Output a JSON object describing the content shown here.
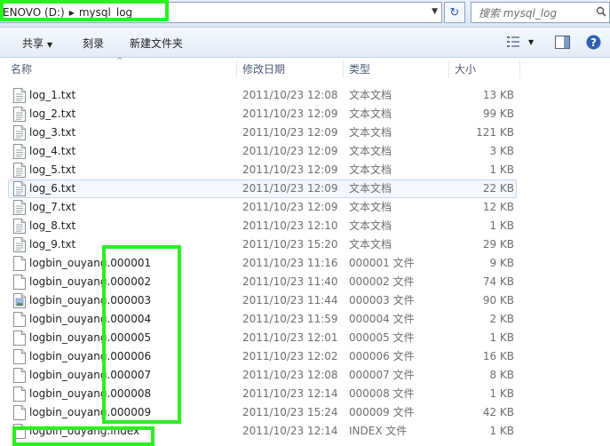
{
  "address": {
    "drive": "ENOVO (D:)",
    "folder": "mysql_log",
    "search_placeholder": "搜索 mysql_log"
  },
  "toolbar": {
    "share": "共享",
    "burn": "刻录",
    "new_folder": "新建文件夹"
  },
  "columns": {
    "name": "名称",
    "date": "修改日期",
    "type": "类型",
    "size": "大小"
  },
  "files": [
    {
      "name": "log_1.txt",
      "date": "2011/10/23 12:08",
      "type": "文本文档",
      "size": "13 KB",
      "icon": "text-file-icon"
    },
    {
      "name": "log_2.txt",
      "date": "2011/10/23 12:09",
      "type": "文本文档",
      "size": "99 KB",
      "icon": "text-file-icon"
    },
    {
      "name": "log_3.txt",
      "date": "2011/10/23 12:09",
      "type": "文本文档",
      "size": "121 KB",
      "icon": "text-file-icon"
    },
    {
      "name": "log_4.txt",
      "date": "2011/10/23 12:09",
      "type": "文本文档",
      "size": "3 KB",
      "icon": "text-file-icon"
    },
    {
      "name": "log_5.txt",
      "date": "2011/10/23 12:09",
      "type": "文本文档",
      "size": "1 KB",
      "icon": "text-file-icon"
    },
    {
      "name": "log_6.txt",
      "date": "2011/10/23 12:09",
      "type": "文本文档",
      "size": "22 KB",
      "icon": "text-file-icon",
      "selected": true
    },
    {
      "name": "log_7.txt",
      "date": "2011/10/23 12:09",
      "type": "文本文档",
      "size": "12 KB",
      "icon": "text-file-icon"
    },
    {
      "name": "log_8.txt",
      "date": "2011/10/23 12:10",
      "type": "文本文档",
      "size": "1 KB",
      "icon": "text-file-icon"
    },
    {
      "name": "log_9.txt",
      "date": "2011/10/23 15:20",
      "type": "文本文档",
      "size": "29 KB",
      "icon": "text-file-icon"
    },
    {
      "name": "logbin_ouyang.000001",
      "date": "2011/10/23 11:16",
      "type": "000001 文件",
      "size": "9 KB",
      "icon": "blank-file-icon"
    },
    {
      "name": "logbin_ouyang.000002",
      "date": "2011/10/23 11:40",
      "type": "000002 文件",
      "size": "74 KB",
      "icon": "blank-file-icon"
    },
    {
      "name": "logbin_ouyang.000003",
      "date": "2011/10/23 11:44",
      "type": "000003 文件",
      "size": "90 KB",
      "icon": "image-file-icon"
    },
    {
      "name": "logbin_ouyang.000004",
      "date": "2011/10/23 11:59",
      "type": "000004 文件",
      "size": "2 KB",
      "icon": "blank-file-icon"
    },
    {
      "name": "logbin_ouyang.000005",
      "date": "2011/10/23 12:01",
      "type": "000005 文件",
      "size": "1 KB",
      "icon": "blank-file-icon"
    },
    {
      "name": "logbin_ouyang.000006",
      "date": "2011/10/23 12:02",
      "type": "000006 文件",
      "size": "16 KB",
      "icon": "blank-file-icon"
    },
    {
      "name": "logbin_ouyang.000007",
      "date": "2011/10/23 12:08",
      "type": "000007 文件",
      "size": "8 KB",
      "icon": "blank-file-icon"
    },
    {
      "name": "logbin_ouyang.000008",
      "date": "2011/10/23 12:14",
      "type": "000008 文件",
      "size": "1 KB",
      "icon": "blank-file-icon"
    },
    {
      "name": "logbin_ouyang.000009",
      "date": "2011/10/23 15:24",
      "type": "000009 文件",
      "size": "42 KB",
      "icon": "blank-file-icon"
    },
    {
      "name": "logbin_ouyang.index",
      "date": "2011/10/23 12:14",
      "type": "INDEX 文件",
      "size": "1 KB",
      "icon": "blank-file-icon"
    }
  ],
  "colors": {
    "highlight": "#2bf01e",
    "selection": "#f3f8fe",
    "header_text": "#4b5a78",
    "meta_text": "#6d6d6d"
  }
}
